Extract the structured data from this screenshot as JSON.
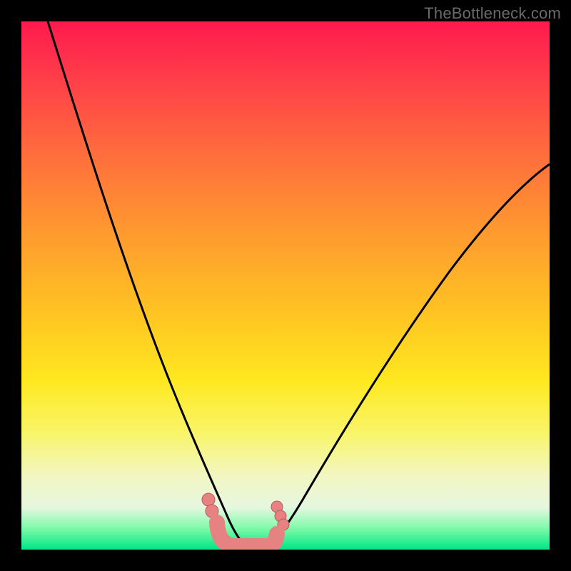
{
  "watermark": "TheBottleneck.com",
  "colors": {
    "frame": "#000000",
    "curve_stroke": "#000000",
    "marker_fill": "#e68282",
    "marker_stroke": "#b85a5a",
    "gradient_top": "#ff1a4d",
    "gradient_bottom": "#00e586"
  },
  "chart_data": {
    "type": "line",
    "title": "",
    "xlabel": "",
    "ylabel": "",
    "xlim": [
      0,
      100
    ],
    "ylim": [
      0,
      100
    ],
    "grid": false,
    "legend": false,
    "series": [
      {
        "name": "left-curve",
        "x": [
          5,
          10,
          15,
          20,
          24,
          27,
          30,
          32,
          34,
          36,
          38,
          40,
          42,
          44
        ],
        "values": [
          100,
          84,
          68,
          52,
          38,
          28,
          20,
          14,
          9,
          5.5,
          3,
          1.5,
          0.5,
          0
        ]
      },
      {
        "name": "right-curve",
        "x": [
          44,
          46,
          48,
          50,
          53,
          57,
          62,
          68,
          75,
          83,
          92,
          100
        ],
        "values": [
          0,
          0.5,
          2,
          5,
          10,
          17,
          26,
          36,
          47,
          57,
          66,
          73
        ]
      },
      {
        "name": "valley-fit",
        "x": [
          36,
          38,
          40,
          42,
          44,
          46,
          48,
          50
        ],
        "values": [
          5.5,
          2,
          0.5,
          0,
          0,
          0.5,
          2,
          5.5
        ]
      }
    ],
    "markers": {
      "left_cluster": [
        {
          "x": 35.5,
          "y": 8
        },
        {
          "x": 36,
          "y": 6
        }
      ],
      "right_cluster": [
        {
          "x": 48.5,
          "y": 7
        },
        {
          "x": 49,
          "y": 5.5
        },
        {
          "x": 49.5,
          "y": 4
        }
      ],
      "valley_pill": {
        "x_start": 37,
        "x_end": 47.5,
        "y": 0.5,
        "thickness": 3.5
      }
    }
  }
}
